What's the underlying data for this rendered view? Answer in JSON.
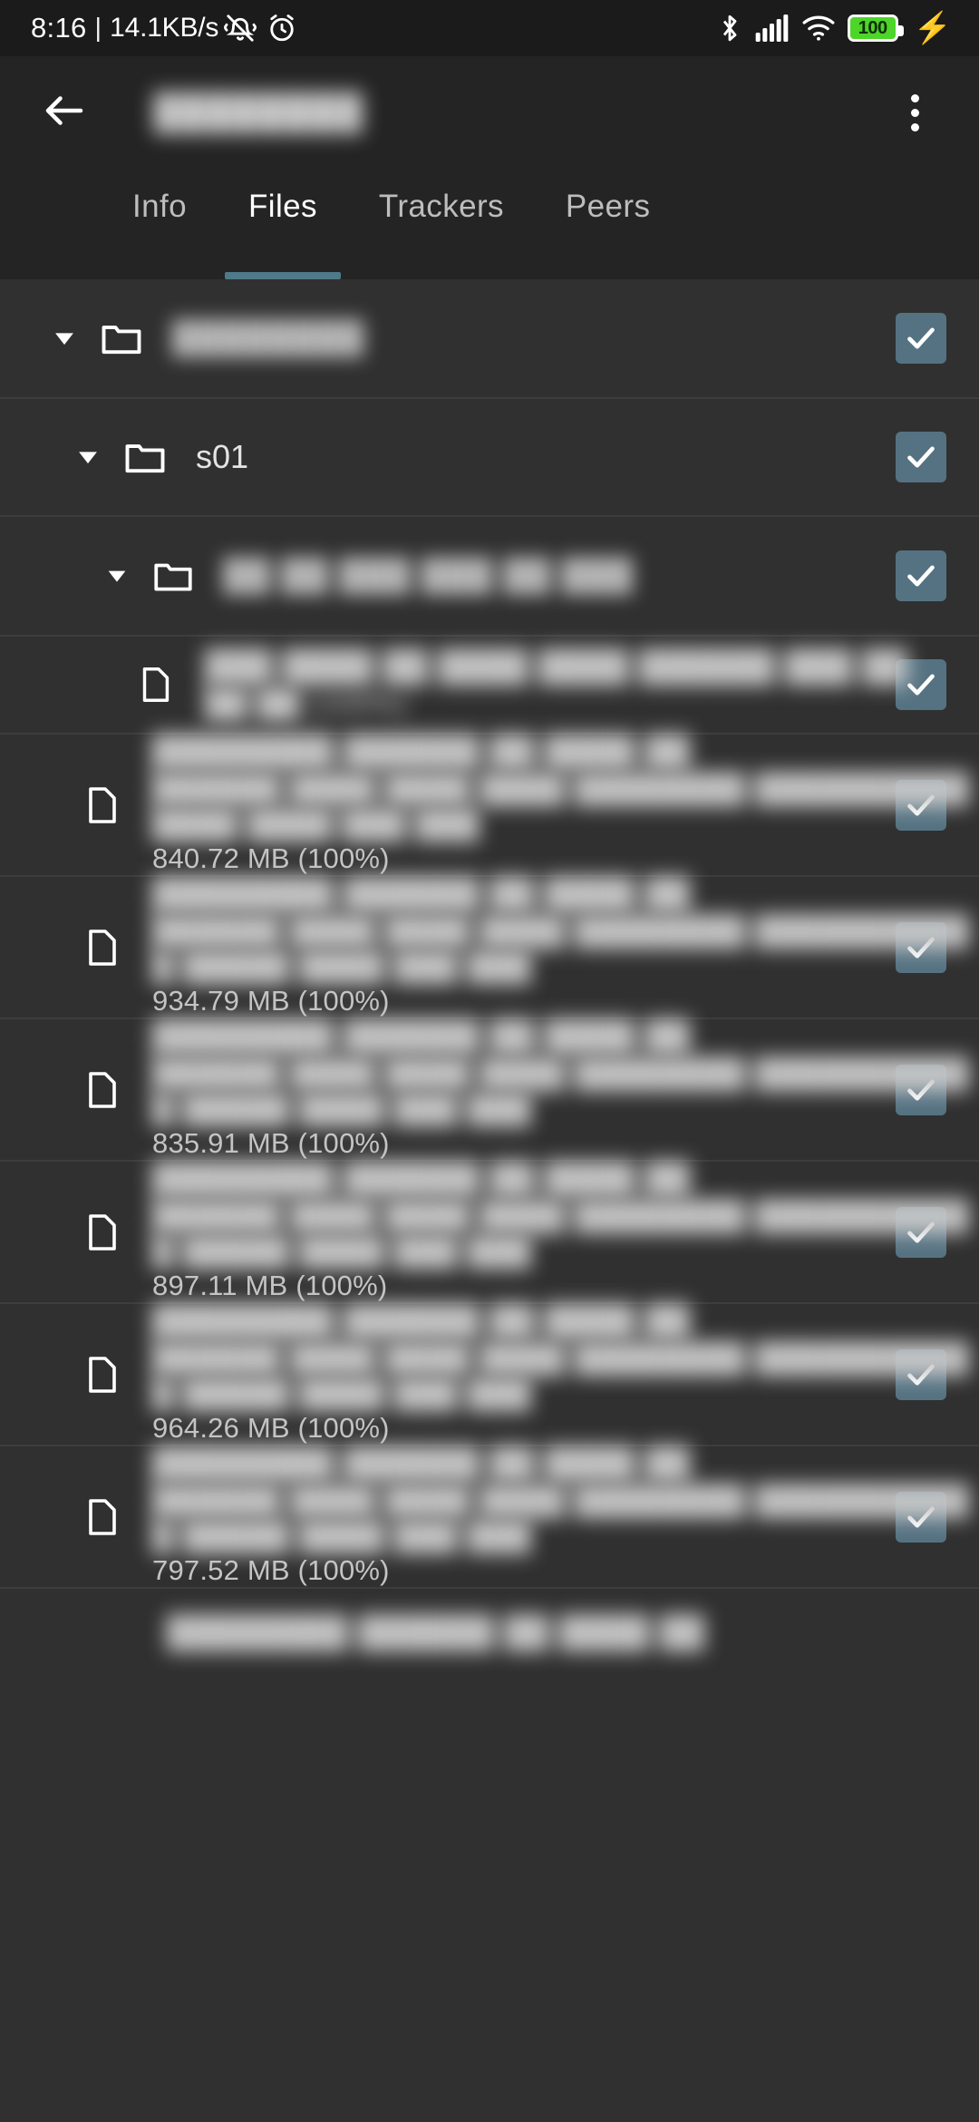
{
  "statusbar": {
    "clock": "8:16",
    "separator": "|",
    "network_speed": "14.1KB/s",
    "mute_icon": "bell-mute-icon",
    "alarm_icon": "alarm-clock-icon",
    "bluetooth_icon": "bluetooth-icon",
    "signal_icon": "cellular-signal-icon",
    "wifi_icon": "wifi-icon",
    "battery_level": "100",
    "charging_icon": "charging-bolt-icon"
  },
  "appbar": {
    "back_icon": "back-arrow-icon",
    "title": "████████",
    "overflow_icon": "overflow-menu-icon"
  },
  "tabs": {
    "active_index": 1,
    "items": [
      {
        "label": "Info"
      },
      {
        "label": "Files"
      },
      {
        "label": "Trackers"
      },
      {
        "label": "Peers"
      }
    ]
  },
  "colors": {
    "accent": "#4f7a8a",
    "checkbox": "#557282",
    "appbar_bg": "#242424",
    "list_bg": "#303030",
    "statusbar_bg": "#1b1b1b",
    "battery_green": "#4dd52a"
  },
  "files": {
    "rows": [
      {
        "level": 0,
        "type": "folder",
        "icon": "folder-icon",
        "expanded": true,
        "caret_icon": "caret-down-icon",
        "name": "████████",
        "blurred": true,
        "size": "",
        "checked": true
      },
      {
        "level": 1,
        "type": "folder",
        "icon": "folder-icon",
        "expanded": true,
        "caret_icon": "caret-down-icon",
        "name": "s01",
        "blurred": false,
        "size": "",
        "checked": true
      },
      {
        "level": 2,
        "type": "folder",
        "icon": "folder-icon",
        "expanded": true,
        "caret_icon": "caret-down-icon",
        "name": "██ ██ ███ ███ ██ ███",
        "blurred": true,
        "size": "",
        "checked": true
      },
      {
        "level": 3,
        "type": "file",
        "icon": "file-icon",
        "name": "███ ████ ██ ████ ████ ██████ ███ ██",
        "name_line2": "██ ██ (100%)",
        "blurred": true,
        "size": "",
        "checked": true
      },
      {
        "level": 3,
        "type": "file",
        "icon": "file-icon",
        "name": "████████ ██████ ██ ████ ██",
        "name_line2": "██████ ████ ████ ████ ████████ ██████████",
        "name_line3": "████ ████ ███ ███",
        "blurred": true,
        "size": "840.72 MB (100%)",
        "checked": true
      },
      {
        "level": 3,
        "type": "file",
        "icon": "file-icon",
        "name": "████████ ██████ ██ ████ ██",
        "name_line2": "██████ ████ ████ ████ ████████ ██████████",
        "name_line3": "█ █████ ████ ███ ███",
        "blurred": true,
        "size": "934.79 MB (100%)",
        "checked": true
      },
      {
        "level": 3,
        "type": "file",
        "icon": "file-icon",
        "name": "████████ ██████ ██ ████ ██",
        "name_line2": "██████ ████ ████ ████ ████████ ██████████",
        "name_line3": "█ █████ ████ ███ ███",
        "blurred": true,
        "size": "835.91 MB (100%)",
        "checked": true
      },
      {
        "level": 3,
        "type": "file",
        "icon": "file-icon",
        "name": "████████ ██████ ██ ████ ██",
        "name_line2": "██████ ████ ████ ████ ████████ ██████████",
        "name_line3": "█ █████ ████ ███ ███",
        "blurred": true,
        "size": "897.11 MB (100%)",
        "checked": true
      },
      {
        "level": 3,
        "type": "file",
        "icon": "file-icon",
        "name": "████████ ██████ ██ ████ ██",
        "name_line2": "██████ ████ ████ ████ ████████ ██████████",
        "name_line3": "█ █████ ████ ███ ███",
        "blurred": true,
        "size": "964.26 MB (100%)",
        "checked": true
      },
      {
        "level": 3,
        "type": "file",
        "icon": "file-icon",
        "name": "████████ ██████ ██ ████ ██",
        "name_line2": "██████ ████ ████ ████ ████████ ██████████",
        "name_line3": "█ █████ ████ ███ ███",
        "blurred": true,
        "size": "797.52 MB (100%)",
        "checked": true
      },
      {
        "level": 3,
        "type": "file",
        "icon": "file-icon",
        "name": "████████ ██████ ██ ████ ██",
        "blurred": true,
        "size": "",
        "checked": true,
        "partial": true
      }
    ]
  }
}
